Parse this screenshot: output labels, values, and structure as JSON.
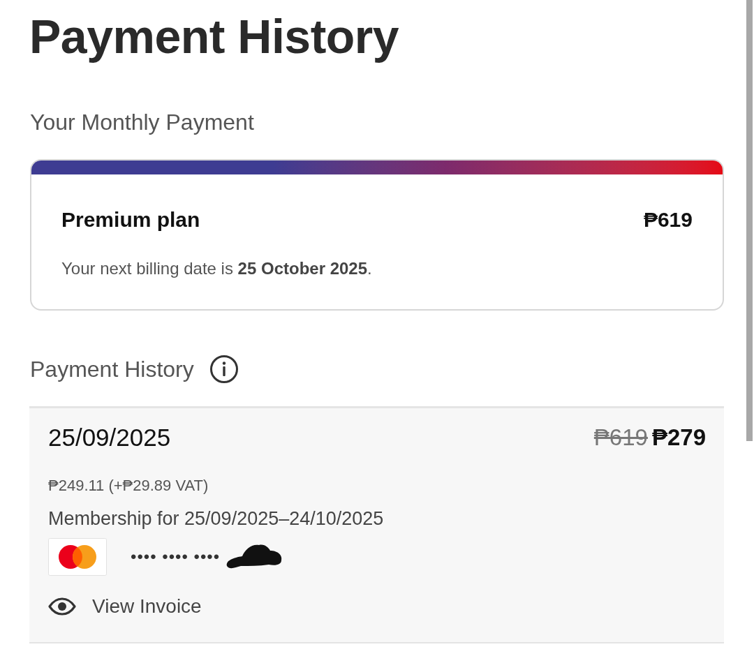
{
  "page": {
    "title": "Payment History"
  },
  "monthly_payment": {
    "heading": "Your Monthly Payment",
    "plan": "Premium plan",
    "price": "₱619",
    "next_billing": "Your next billing date is **25 October 2025**."
  },
  "payment_history": {
    "heading": "Payment History",
    "payments": [
      {
        "date": "25/09/2025",
        "original_price": "₱619",
        "price": "₱279",
        "breakdown": "₱249.11 (+₱29.89 VAT)",
        "period": "Membership for 25/09/2025–24/10/2025",
        "card_number": "•••• •••• ••••",
        "invoice_link": "View Invoice"
      }
    ]
  }
}
